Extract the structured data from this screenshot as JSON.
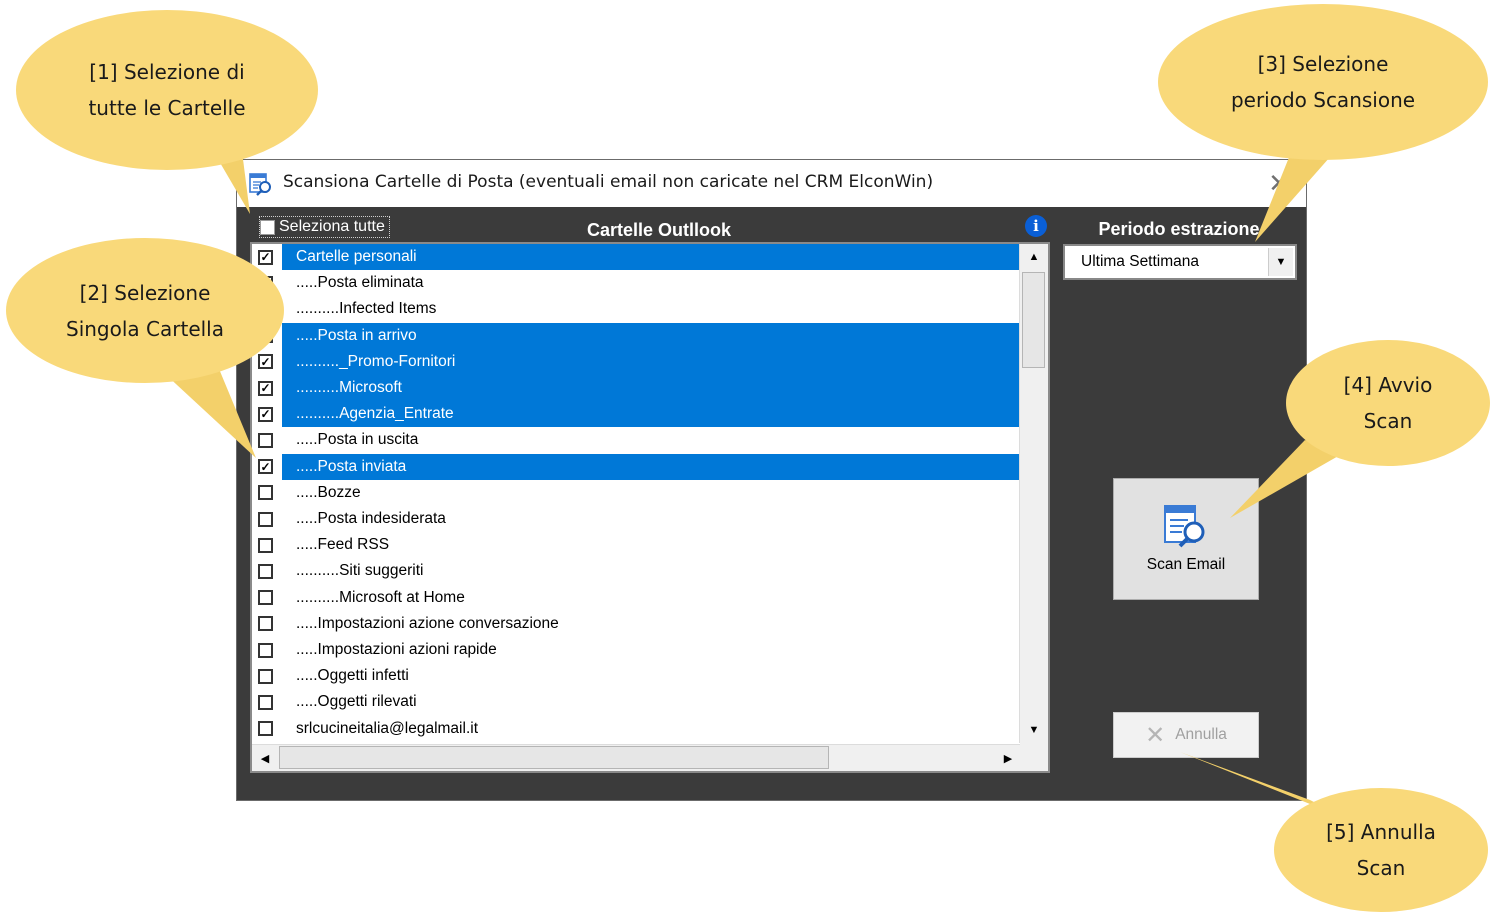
{
  "callouts": {
    "c1": {
      "line1": "[1] Selezione  di",
      "line2": "tutte le Cartelle"
    },
    "c2": {
      "line1": "[2] Selezione",
      "line2": "Singola Cartella"
    },
    "c3": {
      "line1": "[3] Selezione",
      "line2": "periodo Scansione"
    },
    "c4": {
      "line1": "[4] Avvio",
      "line2": "Scan"
    },
    "c5": {
      "line1": "[5] Annulla",
      "line2": "Scan"
    }
  },
  "window": {
    "title": "Scansiona Cartelle di Posta (eventuali email non caricate nel CRM ElconWin)",
    "close_glyph": "✕"
  },
  "select_all": {
    "label": "Seleziona tutte",
    "checked": false
  },
  "list": {
    "header": "Cartelle Outllook",
    "info_glyph": "i",
    "items": [
      {
        "label": "Cartelle personali",
        "checked": true,
        "selected": true
      },
      {
        "label": ".....Posta eliminata",
        "checked": false,
        "selected": false
      },
      {
        "label": "..........Infected Items",
        "checked": false,
        "selected": false
      },
      {
        "label": ".....Posta in arrivo",
        "checked": true,
        "selected": true
      },
      {
        "label": ".........._Promo-Fornitori",
        "checked": true,
        "selected": true
      },
      {
        "label": "..........Microsoft",
        "checked": true,
        "selected": true
      },
      {
        "label": "..........Agenzia_Entrate",
        "checked": true,
        "selected": true
      },
      {
        "label": ".....Posta in uscita",
        "checked": false,
        "selected": false
      },
      {
        "label": ".....Posta inviata",
        "checked": true,
        "selected": true
      },
      {
        "label": ".....Bozze",
        "checked": false,
        "selected": false
      },
      {
        "label": ".....Posta indesiderata",
        "checked": false,
        "selected": false
      },
      {
        "label": ".....Feed RSS",
        "checked": false,
        "selected": false
      },
      {
        "label": "..........Siti suggeriti",
        "checked": false,
        "selected": false
      },
      {
        "label": "..........Microsoft at Home",
        "checked": false,
        "selected": false
      },
      {
        "label": ".....Impostazioni azione conversazione",
        "checked": false,
        "selected": false
      },
      {
        "label": ".....Impostazioni azioni rapide",
        "checked": false,
        "selected": false
      },
      {
        "label": ".....Oggetti infetti",
        "checked": false,
        "selected": false
      },
      {
        "label": ".....Oggetti rilevati",
        "checked": false,
        "selected": false
      },
      {
        "label": "srlcucineitalia@legalmail.it",
        "checked": false,
        "selected": false
      }
    ]
  },
  "period": {
    "label": "Periodo estrazione",
    "value": "Ultima Settimana"
  },
  "buttons": {
    "scan_label": "Scan Email",
    "cancel_label": "Annulla",
    "cancel_enabled": false
  },
  "colors": {
    "callout": "#f9d97a",
    "dialog_bg": "#3b3b3b",
    "selection": "#0078d7",
    "info": "#0a5fd6"
  }
}
